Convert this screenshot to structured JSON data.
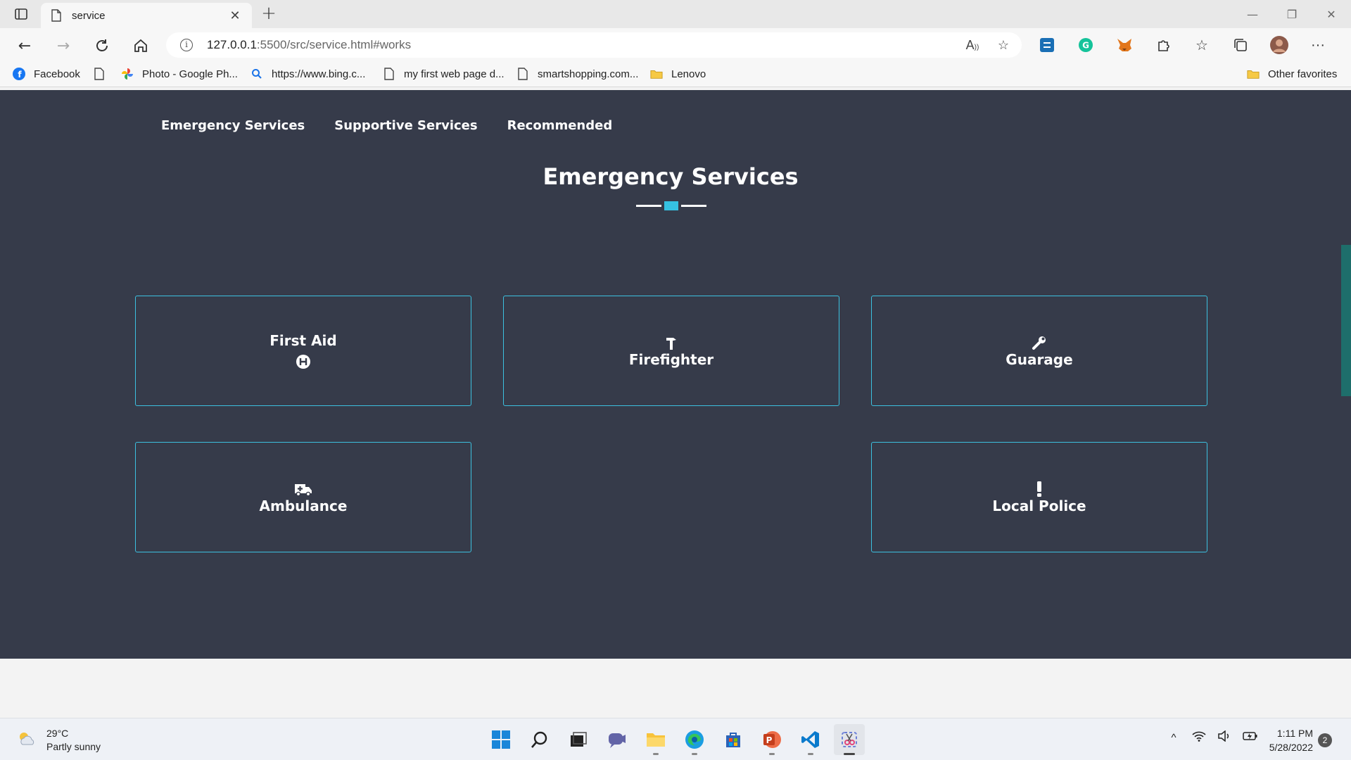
{
  "browser": {
    "tab_title": "service",
    "url_host": "127.0.0.1",
    "url_rest": ":5500/src/service.html#works",
    "bookmarks": [
      {
        "label": "Facebook",
        "icon": "facebook-icon"
      },
      {
        "label": "",
        "icon": "document-icon"
      },
      {
        "label": "Photo - Google Ph...",
        "icon": "google-photos-icon"
      },
      {
        "label": "https://www.bing.c...",
        "icon": "search-icon"
      },
      {
        "label": "my first web page d...",
        "icon": "document-icon"
      },
      {
        "label": "smartshopping.com...",
        "icon": "document-icon"
      },
      {
        "label": "Lenovo",
        "icon": "folder-icon"
      }
    ],
    "other_favorites": "Other favorites"
  },
  "page": {
    "nav": [
      "Emergency Services",
      "Supportive Services",
      "Recommended"
    ],
    "section_title": "Emergency Services",
    "accent_color": "#35c2e3",
    "background_color": "#363b4a",
    "cards": [
      {
        "label": "First Aid",
        "icon": "hospital-icon"
      },
      {
        "label": "Firefighter",
        "icon": "hammer-icon"
      },
      {
        "label": "Guarage",
        "icon": "wrench-icon"
      },
      {
        "label": "Ambulance",
        "icon": "ambulance-icon"
      },
      {
        "label": "Local Police",
        "icon": "exclamation-icon"
      }
    ]
  },
  "taskbar": {
    "temperature": "29°C",
    "weather": "Partly sunny",
    "time": "1:11 PM",
    "date": "5/28/2022",
    "notifications": "2"
  }
}
